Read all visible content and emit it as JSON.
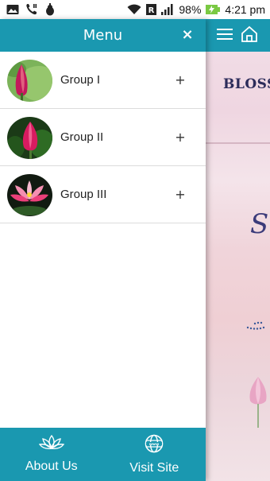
{
  "status_bar": {
    "battery_percent": "98%",
    "time": "4:21 pm",
    "icons": [
      "image-icon",
      "call-settings-icon",
      "android-debug-icon",
      "wifi-icon",
      "r-icon",
      "signal-icon",
      "battery-charging-icon"
    ]
  },
  "drawer": {
    "title": "Menu",
    "close_label": "×",
    "groups": [
      {
        "label": "Group I",
        "expand": "+"
      },
      {
        "label": "Group II",
        "expand": "+"
      },
      {
        "label": "Group III",
        "expand": "+"
      }
    ],
    "footer": {
      "about_label": "About Us",
      "visit_label": "Visit Site"
    }
  },
  "background_app": {
    "logo_text": "BLOSSO",
    "script_text": "S"
  },
  "colors": {
    "accent": "#1a98b0",
    "divider": "#dcdcdc"
  }
}
